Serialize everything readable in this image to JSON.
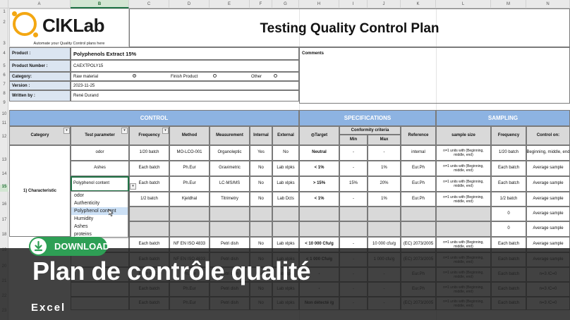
{
  "columns": [
    "A",
    "B",
    "C",
    "D",
    "E",
    "F",
    "G",
    "H",
    "I",
    "J",
    "K",
    "L",
    "M",
    "N"
  ],
  "rows": [
    "1",
    "2",
    "3",
    "4",
    "5",
    "6",
    "7",
    "8",
    "9",
    "10",
    "11",
    "12",
    "13",
    "14",
    "15",
    "16",
    "17",
    "18",
    "19",
    "20",
    "21",
    "22",
    "23"
  ],
  "logo": {
    "brand": "ClKLab",
    "tagline": "Automate your Quality Control plans here"
  },
  "title": "Testing Quality Control Plan",
  "info": {
    "product_label": "Product :",
    "product_value": "Polyphenols Extract 15%",
    "product_number_label": "Product Number :",
    "product_number_value": "CAEXTPOLY15",
    "category_label": "Category:",
    "category_opt1": "Raw material",
    "category_opt2": "Finish Product",
    "category_opt3": "Other",
    "version_label": "Version :",
    "version_value": "2023-11-25",
    "written_label": "Written by :",
    "written_value": "René Durand",
    "comments_label": "Comments"
  },
  "sections": {
    "control": "CONTROL",
    "specifications": "SPECIFICATIONS",
    "sampling": "SAMPLING"
  },
  "headers": {
    "category": "Category",
    "test_parameter": "Test parameter",
    "frequency": "Frequency",
    "method": "Method",
    "measurement": "Measurement",
    "internal": "Internal",
    "external": "External",
    "target": "Target",
    "conformity": "Conformity criteria",
    "min": "Min",
    "max": "Max",
    "reference": "Reference",
    "sample_size": "sample size",
    "s_frequency": "Frequency",
    "control_on": "Control on:"
  },
  "category_cell": "1) Characteristic",
  "table": [
    [
      "odor",
      "1/20 batch",
      "MO-LCO-001",
      "Organoleptic",
      "Yes",
      "No",
      "Neutral",
      "-",
      "-",
      "internal",
      "n=1 units with (Beginning, middle, end)",
      "1/20 batch",
      "Beginning, middle, end"
    ],
    [
      "Ashes",
      "Each batch",
      "Ph.Eur",
      "Gravimetric",
      "No",
      "Lab xlpks",
      "< 1%",
      "-",
      "1%",
      "Eur.Ph",
      "n=1 units with (Beginning, middle, end)",
      "Each batch",
      "Average sample"
    ],
    [
      "Polyphenol content",
      "Each batch",
      "Ph.Eur",
      "LC-MS/MS",
      "No",
      "Lab xlpks",
      "> 15%",
      "15%",
      "20%",
      "Eur.Ph",
      "n=1 units with (Beginning, middle, end)",
      "Each batch",
      "Average sample"
    ],
    [
      "",
      "1/2 batch",
      "Kjeldhal",
      "Titrimetry",
      "No",
      "Lab Dcts",
      "< 1%",
      "-",
      "1%",
      "Eur.Ph",
      "n=1 units with (Beginning, middle, end)",
      "1/2 batch",
      "Average sample"
    ],
    [
      "",
      "",
      "",
      "",
      "",
      "",
      "",
      "",
      "",
      "",
      "",
      "0",
      "Average sample"
    ],
    [
      "",
      "",
      "",
      "",
      "",
      "",
      "",
      "",
      "",
      "",
      "",
      "0",
      "Average sample"
    ],
    [
      "",
      "Each batch",
      "NF EN ISO 4833",
      "Petri dish",
      "No",
      "Lab xlpks",
      "< 10 000 Cfu/g",
      "-",
      "10 000 cfu/g",
      "(EC) 2073/2005",
      "n=1 units with (Beginning, middle, end)",
      "Each batch",
      "Average sample"
    ],
    [
      "",
      "Each batch",
      "NF EN ISO 4833",
      "Petri dish",
      "No",
      "Lab xlpks",
      "< 1 000 Cfu/g",
      "-",
      "1 000 cfu/g",
      "(EC) 2073/2005",
      "n=1 units with (Beginning, middle, end)",
      "Each batch",
      "Average sample"
    ],
    [
      "",
      "Each batch",
      "Ph.Eur",
      "Petri dish",
      "No",
      "Lab xlpks",
      "-",
      "-",
      "-",
      "Eur.Ph",
      "n=1 units with (Beginning, middle, end)",
      "Each batch",
      "n=3 /C=0"
    ],
    [
      "",
      "Each batch",
      "Ph.Eur",
      "Petri dish",
      "No",
      "Lab xlpks",
      "-",
      "-",
      "-",
      "Eur.Ph",
      "n=1 units with (Beginning, middle, end)",
      "Each batch",
      "n=3 /C=0"
    ],
    [
      "",
      "Each batch",
      "Ph.Eur",
      "Petri dish",
      "No",
      "Lab xlpks",
      "Non détecté /g",
      "-",
      "-",
      "(EC) 2073/2005",
      "n=1 units with (Beginning, middle, end)",
      "Each batch",
      "n=3 /C=0"
    ]
  ],
  "dropdown": {
    "options": [
      "odor",
      "Authenticity",
      "Polyphenol content",
      "Humidity",
      "Ashes",
      "proteins"
    ],
    "highlighted": 2
  },
  "download_label": "DOWNLOAD",
  "banner": {
    "title": "Plan de contrôle qualité",
    "subtitle": "Excel"
  },
  "colors": {
    "section_header": "#8db3e2",
    "label_fill": "#dbe5f1",
    "logo_accent": "#f3a712",
    "download": "#2e9f55"
  }
}
